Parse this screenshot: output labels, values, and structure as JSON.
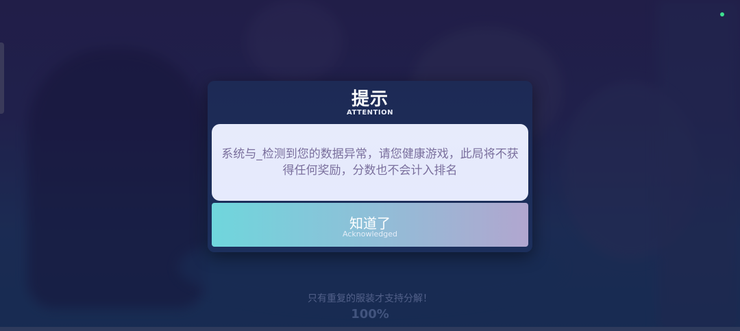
{
  "background": {
    "hint": "只有重复的服装才支持分解！",
    "percent": "100%"
  },
  "dialog": {
    "title": "提示",
    "subtitle": "ATTENTION",
    "message": "系统与_检测到您的数据异常，请您健康游戏，此局将不获得任何奖励，分数也不会计入排名",
    "button_label": "知道了",
    "button_sub": "Acknowledged"
  },
  "colors": {
    "dialog_bg": "#1d2a55",
    "message_bg": "#e7ebfb",
    "message_text": "#7a6f9d",
    "button_gradient_start": "#6fd6dc",
    "button_gradient_end": "#b1a6cf",
    "status_dot": "#3ee08f"
  }
}
